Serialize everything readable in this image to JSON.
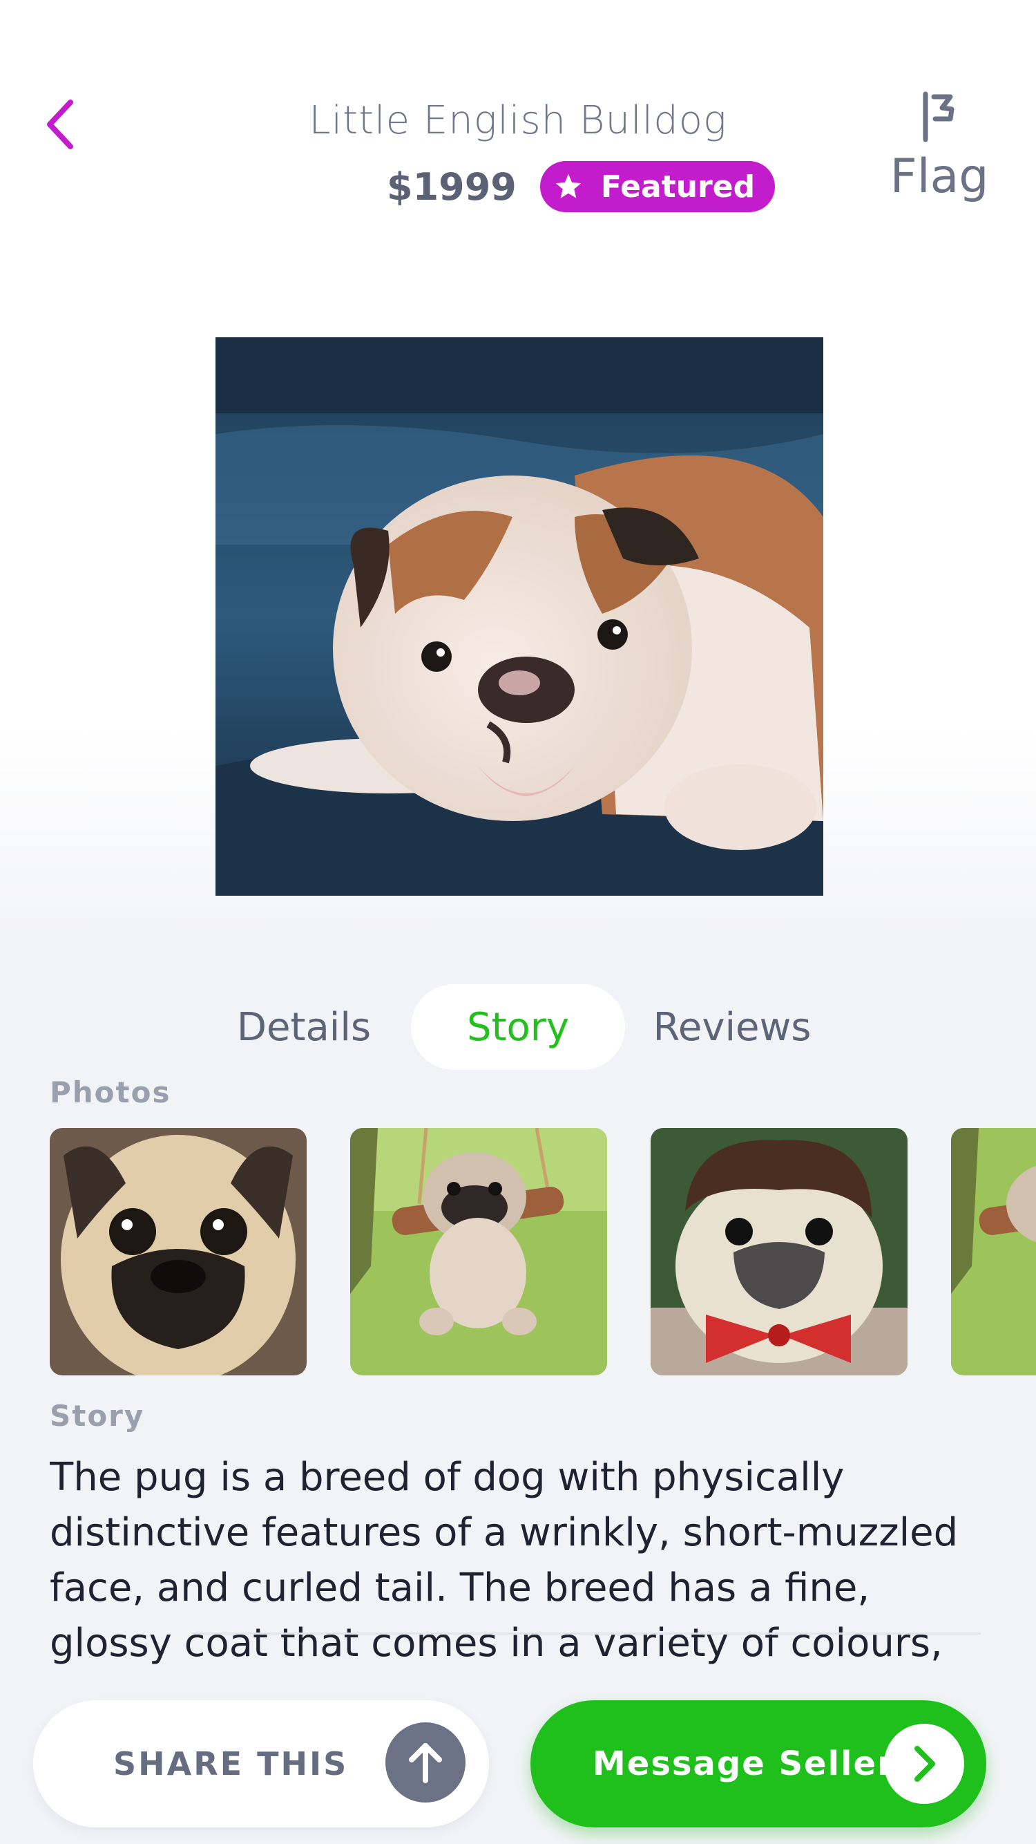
{
  "header": {
    "title": "Little English Bulldog",
    "price": "$1999",
    "badge": "Featured",
    "flag_label": "Flag"
  },
  "tabs": [
    {
      "label": "Details",
      "active": false
    },
    {
      "label": "Story",
      "active": true
    },
    {
      "label": "Reviews",
      "active": false
    }
  ],
  "photos": {
    "label": "Photos"
  },
  "story": {
    "label": "Story",
    "text": "The pug is a breed of dog with physically distinctive features of a wrinkly, short-muzzled face, and curled tail. The breed has a fine, glossy coat that comes in a variety of colours, most"
  },
  "actions": {
    "share_label": "SHARE THIS",
    "message_label": "Message Seller"
  },
  "colors": {
    "accent_purple": "#c21ccc",
    "accent_green": "#1fc01c",
    "text_gray": "#5a6178"
  }
}
